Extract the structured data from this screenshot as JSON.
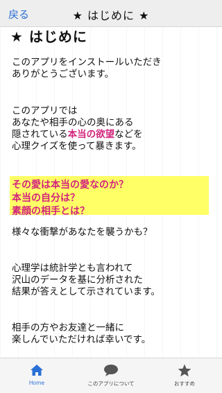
{
  "header": {
    "back_label": "戻る",
    "title": "★ はじめに ★"
  },
  "content": {
    "title": "★ はじめに",
    "p1": [
      "このアプリをインストールいただき",
      "ありがとうございます。"
    ],
    "p2": {
      "line1": "このアプリでは",
      "line2": "あなたや相手の心の奥にある",
      "line3_pre": "隠されている",
      "line3_em": "本当の欲望",
      "line3_post": "などを",
      "line4": "心理クイズを使って暴きます。"
    },
    "highlight": [
      "その愛は本当の愛なのか？",
      "本当の自分は？",
      "素顔の相手とは？"
    ],
    "p3": "様々な衝撃があなたを襲うかも？",
    "p4": [
      "心理学は統計学とも言われて",
      "沢山のデータを基に分析された",
      "結果が答えとして示されています。"
    ],
    "p5": [
      "相手の方やお友達と一緒に",
      "楽しんでいただければ幸いです。"
    ]
  },
  "bottom_nav": {
    "items": [
      {
        "label": "Home",
        "icon": "home-icon"
      },
      {
        "label": "このアプリについて",
        "icon": "chat-bubble-icon"
      },
      {
        "label": "おすすめ",
        "icon": "star-icon"
      }
    ]
  },
  "colors": {
    "accent": "#2a6fd6",
    "emphasis": "#d2247c",
    "highlight": "#ffff66"
  }
}
